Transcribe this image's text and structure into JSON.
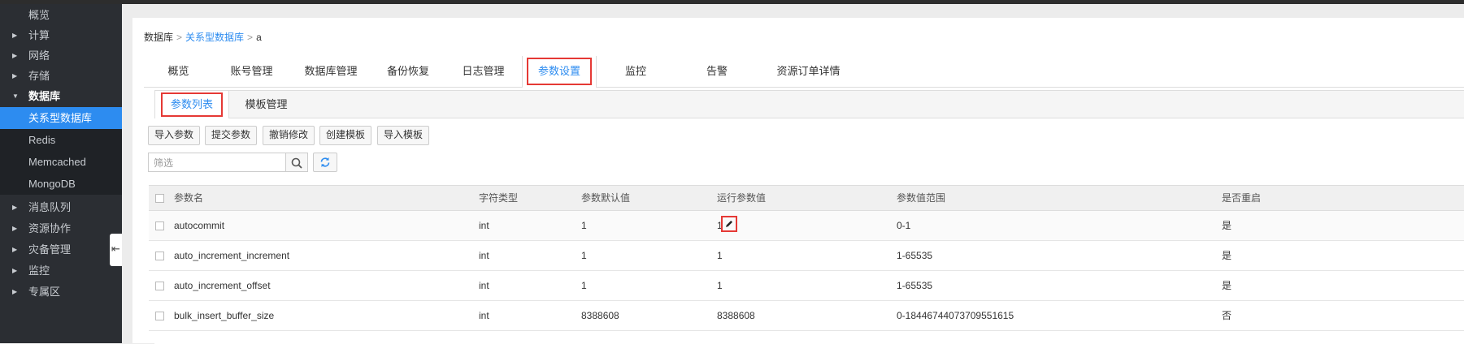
{
  "sidebar": {
    "items": [
      {
        "label": "概览",
        "caret": false
      },
      {
        "label": "计算",
        "caret": true
      },
      {
        "label": "网络",
        "caret": true
      },
      {
        "label": "存储",
        "caret": true
      },
      {
        "label": "数据库",
        "caret": true,
        "open": true
      },
      {
        "label": "消息队列",
        "caret": true
      },
      {
        "label": "资源协作",
        "caret": true
      },
      {
        "label": "灾备管理",
        "caret": true
      },
      {
        "label": "监控",
        "caret": true
      },
      {
        "label": "专属区",
        "caret": true
      }
    ],
    "db_sub": [
      "关系型数据库",
      "Redis",
      "Memcached",
      "MongoDB"
    ],
    "active_sub": "关系型数据库"
  },
  "breadcrumb": {
    "root": "数据库",
    "link": "关系型数据库",
    "current": "a",
    "sep": ">"
  },
  "main_tabs": [
    "概览",
    "账号管理",
    "数据库管理",
    "备份恢复",
    "日志管理",
    "参数设置",
    "监控",
    "告警",
    "资源订单详情"
  ],
  "active_main_tab": "参数设置",
  "sub_tabs": [
    "参数列表",
    "模板管理"
  ],
  "active_sub_tab": "参数列表",
  "toolbar": [
    "导入参数",
    "提交参数",
    "撤销修改",
    "创建模板",
    "导入模板"
  ],
  "filter": {
    "placeholder": "筛选"
  },
  "table": {
    "headers": [
      "参数名",
      "字符类型",
      "参数默认值",
      "运行参数值",
      "参数值范围",
      "是否重启"
    ],
    "rows": [
      [
        "autocommit",
        "int",
        "1",
        "1",
        "0-1",
        "是"
      ],
      [
        "auto_increment_increment",
        "int",
        "1",
        "1",
        "1-65535",
        "是"
      ],
      [
        "auto_increment_offset",
        "int",
        "1",
        "1",
        "1-65535",
        "是"
      ],
      [
        "bulk_insert_buffer_size",
        "int",
        "8388608",
        "8388608",
        "0-18446744073709551615",
        "否"
      ]
    ]
  },
  "colors": {
    "accent": "#2d8cf0",
    "highlight": "#e53935",
    "sidebar_bg": "#2b2e33"
  },
  "icons": {
    "caret": "caret-right-icon",
    "search": "search-icon",
    "refresh": "refresh-icon",
    "edit": "pencil-icon",
    "collapse": "collapse-sidebar-icon"
  }
}
